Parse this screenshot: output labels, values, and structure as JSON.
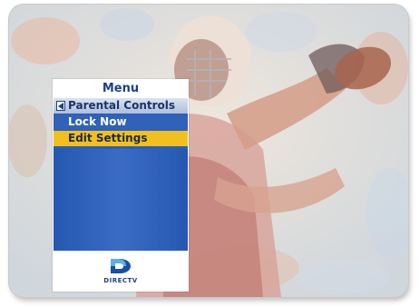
{
  "menu": {
    "title": "Menu",
    "items": [
      {
        "label": "Parental Controls",
        "state": "parent"
      },
      {
        "label": "Lock Now",
        "state": "normal"
      },
      {
        "label": "Edit Settings",
        "state": "selected"
      }
    ]
  },
  "brand": {
    "name": "DIRECTV"
  },
  "colors": {
    "menu_blue": "#2a5fb8",
    "highlight_yellow": "#f2c01e",
    "header_text": "#1b3f8a"
  },
  "icons": [
    "back-arrow-icon",
    "directv-logo-icon"
  ]
}
